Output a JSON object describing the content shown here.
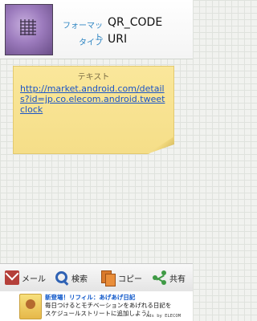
{
  "header": {
    "format_label": "フォーマット",
    "format_value": "QR_CODE",
    "type_label": "タイプ",
    "type_value": "URI"
  },
  "note": {
    "title": "テキスト",
    "link": "http://market.android.com/details?id=jp.co.elecom.android.tweetclock"
  },
  "toolbar": {
    "mail_icon": "mail-icon",
    "mail_label": "メール",
    "search_icon": "search-icon",
    "search_label": "検索",
    "copy_icon": "copy-icon",
    "copy_label": "コピー",
    "share_icon": "share-icon",
    "share_label": "共有"
  },
  "ad": {
    "line1": "新登場！リフィル：あげあげ日記",
    "line2": "毎日つけるとモチベーションをあげれる日記を",
    "line3": "スケジュールストリートに追加しよう！",
    "by": "Ads by ELECOM"
  },
  "colors": {
    "accent_label": "#2f86c3",
    "note_bg": "#f5de88",
    "link": "#1b55c7",
    "ad_headline": "#0a54c8"
  }
}
